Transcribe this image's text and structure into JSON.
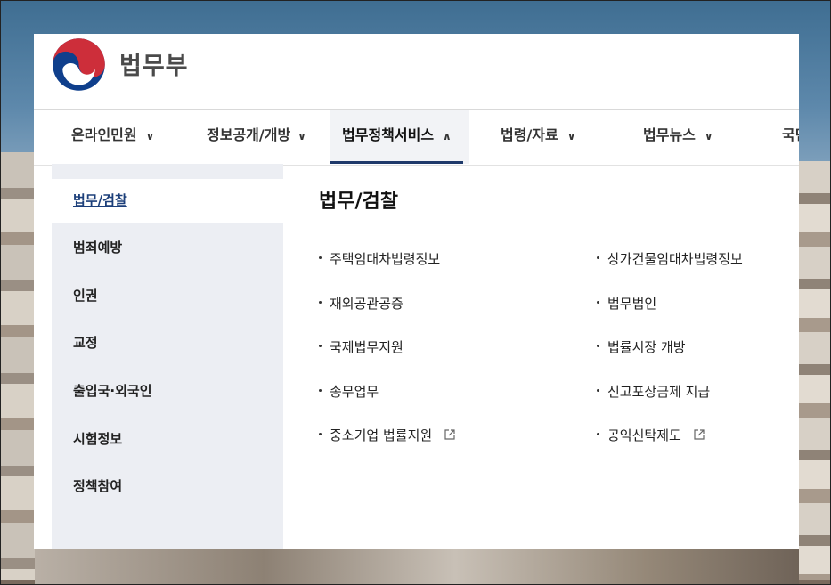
{
  "site": {
    "brand_name": "법무부"
  },
  "gnb": {
    "items": [
      {
        "label": "온라인민원",
        "expanded": false
      },
      {
        "label": "정보공개/개방",
        "expanded": false
      },
      {
        "label": "법무정책서비스",
        "expanded": true
      },
      {
        "label": "법령/자료",
        "expanded": false
      },
      {
        "label": "법무뉴스",
        "expanded": false
      },
      {
        "label": "국민"
      }
    ]
  },
  "sidebar": {
    "items": [
      {
        "label": "법무/검찰",
        "active": true
      },
      {
        "label": "범죄예방"
      },
      {
        "label": "인권"
      },
      {
        "label": "교정"
      },
      {
        "label": "출입국·외국인"
      },
      {
        "label": "시험정보"
      },
      {
        "label": "정책참여"
      }
    ]
  },
  "content": {
    "title": "법무/검찰",
    "links_left": [
      {
        "label": "주택임대차법령정보",
        "external": false
      },
      {
        "label": "재외공관공증",
        "external": false
      },
      {
        "label": "국제법무지원",
        "external": false
      },
      {
        "label": "송무업무",
        "external": false
      },
      {
        "label": "중소기업 법률지원",
        "external": true
      }
    ],
    "links_right": [
      {
        "label": "상가건물임대차법령정보",
        "external": false
      },
      {
        "label": "법무법인",
        "external": false
      },
      {
        "label": "법률시장 개방",
        "external": false
      },
      {
        "label": "신고포상금제 지급",
        "external": false
      },
      {
        "label": "공익신탁제도",
        "external": true
      }
    ]
  },
  "colors": {
    "accent_navy": "#1f3a6b",
    "sidebar_bg": "#eceef3",
    "logo_red": "#cd2e3a",
    "logo_blue": "#0f3f8c"
  },
  "icons": {
    "chevron_down": "chevron-down-icon",
    "chevron_up": "chevron-up-icon",
    "external": "external-link-icon"
  }
}
